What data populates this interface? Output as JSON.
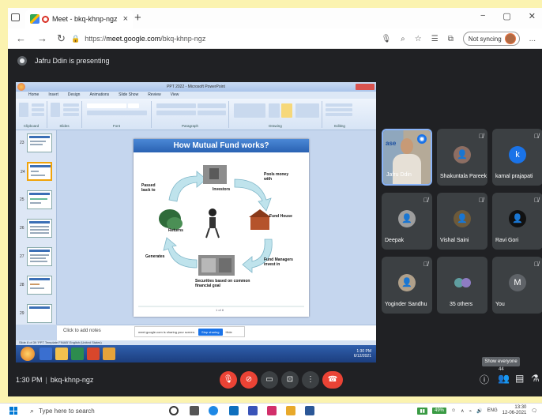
{
  "browser": {
    "tab_title": "Meet - bkq-khnp-ngz",
    "tab_close": "×",
    "new_tab": "+",
    "url_prefix": "https://",
    "url_host": "meet.google.com",
    "url_path": "/bkq-khnp-ngz",
    "not_syncing": "Not syncing",
    "more": "...",
    "win_min": "−",
    "win_max": "▢",
    "win_close": "✕"
  },
  "meet": {
    "presenting_text": "Jafru Ddin is presenting",
    "time": "1:30 PM",
    "separator": "|",
    "meeting_code": "bkq-khnp-ngz",
    "tooltip": "Show everyone",
    "people_count": "44"
  },
  "ppt": {
    "window_title": "PPT 2022 - Microsoft PowerPoint",
    "tabs": [
      "Home",
      "Insert",
      "Design",
      "Animations",
      "Slide Show",
      "Review",
      "View"
    ],
    "groups": [
      "Clipboard",
      "Slides",
      "Font",
      "Paragraph",
      "Drawing",
      "Editing"
    ],
    "slide_title": "How Mutual Fund works?",
    "labels": {
      "passed_back": "Passed back to",
      "investors": "Investors",
      "pools_money": "Pools money with",
      "fund_house": "Fund House",
      "returns": "Returns",
      "generates": "Generates",
      "fund_managers": "Fund Managers invest in",
      "securities": "Securities based on common financial goal"
    },
    "slide_number": "1 of 8",
    "notes": "Click to add notes",
    "share_text": "meet.google.com is sharing your screen.",
    "stop_sharing": "Stop sharing",
    "hide": "Hide",
    "status": "Slide 8 of 39    'PPT Template FINAB'    English (United States)",
    "xp_time": "1:30 PM",
    "xp_date": "6/12/2021",
    "thumb_numbers": [
      "23",
      "24",
      "25",
      "26",
      "27",
      "28",
      "29"
    ]
  },
  "participants": [
    {
      "name": "Jafru Ddin",
      "initial": "",
      "color": "#4d5a66",
      "video": true
    },
    {
      "name": "Shakuntala Pareek",
      "initial": "",
      "color": "#8d6e63",
      "video": false
    },
    {
      "name": "kamal prajapati",
      "initial": "k",
      "color": "#1a73e8",
      "video": false
    },
    {
      "name": "Deepak",
      "initial": "",
      "color": "#9e9e9e",
      "video": false
    },
    {
      "name": "Vishal Saini",
      "initial": "",
      "color": "#6d5a3a",
      "video": false
    },
    {
      "name": "Ravi Gori",
      "initial": "",
      "color": "#111111",
      "video": false
    },
    {
      "name": "Yoginder Sandhu",
      "initial": "",
      "color": "#b0a08a",
      "video": false
    },
    {
      "name": "35 others",
      "initial": "",
      "color": "#3c4043",
      "video": false
    },
    {
      "name": "You",
      "initial": "M",
      "color": "#5f6368",
      "video": false
    }
  ],
  "taskbar": {
    "search_placeholder": "Type here to search",
    "language": "ENG",
    "time": "13:30",
    "date": "12-06-2021",
    "battery": "49%"
  },
  "colors": {
    "meet_bg": "#202124",
    "tile_bg": "#3c4043",
    "end_call": "#ea4335",
    "accent": "#1a73e8",
    "slide_title_bg": "#2a62b3"
  }
}
